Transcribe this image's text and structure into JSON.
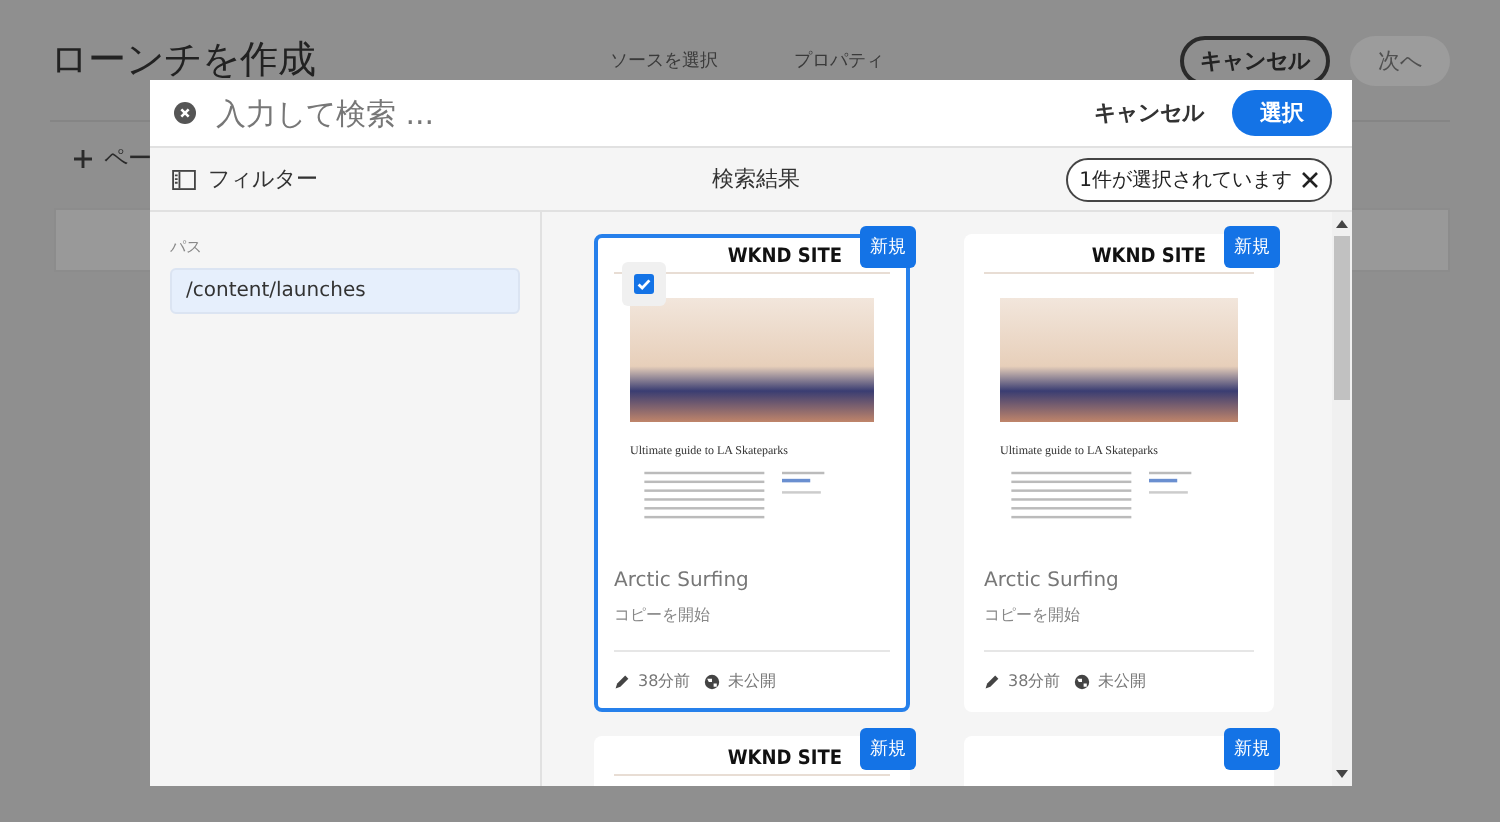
{
  "page": {
    "title": "ローンチを作成",
    "steps": [
      "ソースを選択",
      "プロパティ"
    ],
    "cancel": "キャンセル",
    "next": {
      "label": "次へ",
      "disabled": true
    },
    "add_page": "ペー"
  },
  "dialog": {
    "search": {
      "placeholder": "入力して検索 ..."
    },
    "cancel": "キャンセル",
    "select": "選択",
    "filter": "フィルター",
    "results_title": "検索結果",
    "selection": "1件が選択されています",
    "path_label": "パス",
    "path": "/content/launches",
    "cards": [
      {
        "badge": "新規",
        "selected": true,
        "kind": "article",
        "site": "WKND SITE",
        "headline": "Ultimate guide to LA Skateparks",
        "title": "Arctic Surfing",
        "subtitle": "コピーを開始",
        "modified": "38分前",
        "status": "未公開"
      },
      {
        "badge": "新規",
        "selected": false,
        "kind": "article",
        "site": "WKND SITE",
        "headline": "Ultimate guide to LA Skateparks",
        "title": "Arctic Surfing",
        "subtitle": "コピーを開始",
        "modified": "38分前",
        "status": "未公開"
      },
      {
        "badge": "新規",
        "selected": false,
        "kind": "grid",
        "site": "WKND SITE"
      },
      {
        "badge": "新規",
        "selected": false,
        "kind": "blank"
      }
    ]
  }
}
